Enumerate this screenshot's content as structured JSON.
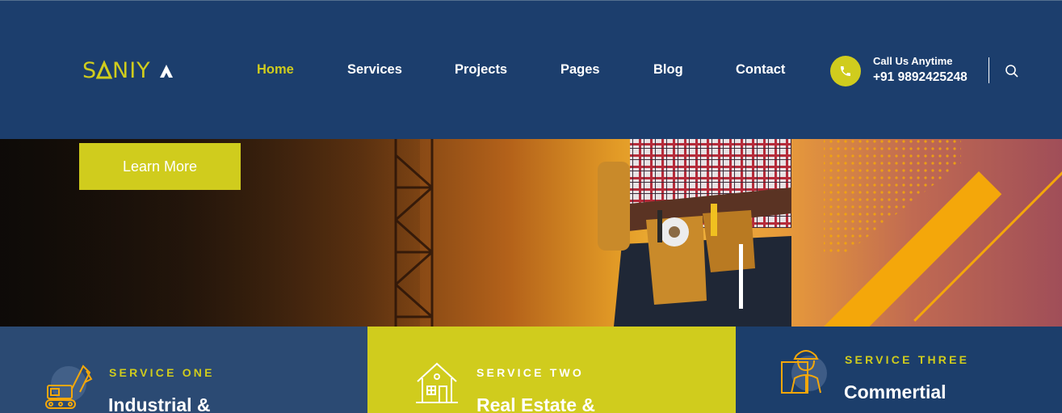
{
  "brand": {
    "logo_text": "SANIYA",
    "primary_color": "#1c3e6d",
    "accent_color": "#d0cc1d"
  },
  "nav": {
    "items": [
      {
        "label": "Home",
        "active": true
      },
      {
        "label": "Services",
        "active": false
      },
      {
        "label": "Projects",
        "active": false
      },
      {
        "label": "Pages",
        "active": false
      },
      {
        "label": "Blog",
        "active": false
      },
      {
        "label": "Contact",
        "active": false
      }
    ]
  },
  "contact": {
    "label": "Call Us Anytime",
    "phone": "+91 9892425248",
    "icon": "phone-icon"
  },
  "search": {
    "icon": "search-icon"
  },
  "hero": {
    "button_label": "Learn More"
  },
  "services": [
    {
      "label": "SERVICE ONE",
      "title": "Industrial &",
      "icon": "excavator-icon"
    },
    {
      "label": "SERVICE TWO",
      "title": "Real Estate &",
      "icon": "house-icon"
    },
    {
      "label": "SERVICE THREE",
      "title": "Commertial",
      "icon": "worker-icon"
    }
  ]
}
